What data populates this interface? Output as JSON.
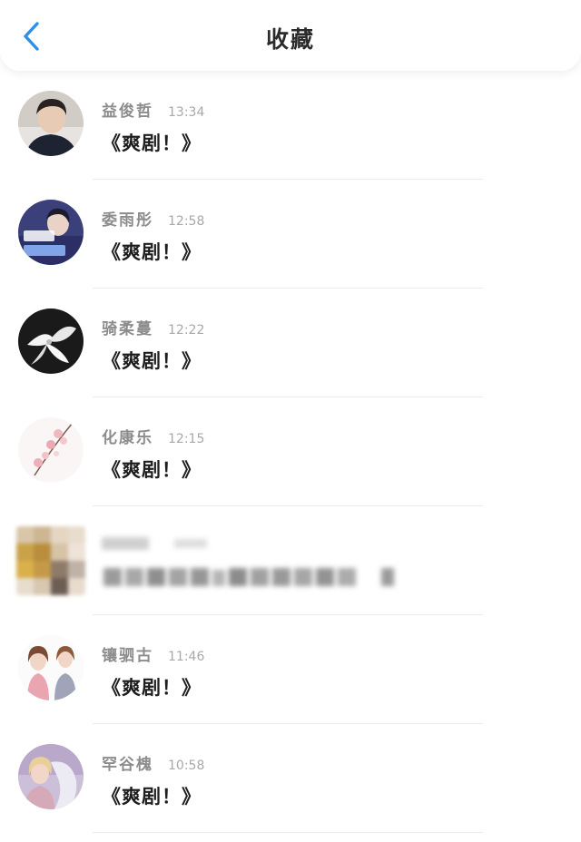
{
  "header": {
    "title": "收藏",
    "back_icon": "chevron-left-icon",
    "back_color": "#2f8fe8"
  },
  "items": [
    {
      "name": "益俊哲",
      "time": "13:34",
      "message": "《爽剧！》"
    },
    {
      "name": "委雨彤",
      "time": "12:58",
      "message": "《爽剧！》"
    },
    {
      "name": "骑柔蔓",
      "time": "12:22",
      "message": "《爽剧！》"
    },
    {
      "name": "化康乐",
      "time": "12:15",
      "message": "《爽剧！》"
    },
    {
      "name": "",
      "time": "",
      "message": "",
      "pixelated": true
    },
    {
      "name": "镶驷古",
      "time": "11:46",
      "message": "《爽剧！》"
    },
    {
      "name": "罕谷槐",
      "time": "10:58",
      "message": "《爽剧！》"
    }
  ]
}
